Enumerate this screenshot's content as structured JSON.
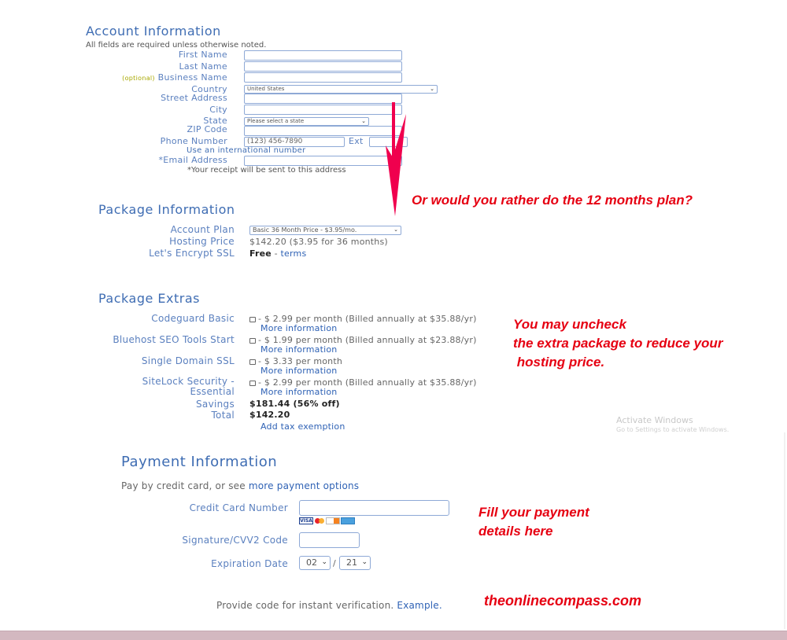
{
  "account": {
    "title": "Account Information",
    "required_note": "All fields are required unless otherwise noted.",
    "first_name_label": "First Name",
    "last_name_label": "Last Name",
    "optional_tag": "(optional)",
    "business_name_label": "Business Name",
    "country_label": "Country",
    "country_value": "United States",
    "street_label": "Street Address",
    "city_label": "City",
    "state_label": "State",
    "state_value": "Please select a state",
    "zip_label": "ZIP Code",
    "phone_label": "Phone Number",
    "phone_placeholder": "(123) 456-7890",
    "ext_label": "Ext",
    "intl_link": "Use an international number",
    "email_label": "*Email Address",
    "email_note": "*Your receipt will be sent to this address"
  },
  "package": {
    "title": "Package Information",
    "plan_label": "Account Plan",
    "plan_value": "Basic 36 Month Price - $3.95/mo.",
    "price_label": "Hosting Price",
    "price_value": "$142.20  ($3.95 for 36 months)",
    "ssl_label": "Let's Encrypt SSL",
    "ssl_value": "Free",
    "ssl_sep": " - ",
    "ssl_terms": "terms"
  },
  "extras": {
    "title": "Package Extras",
    "items": [
      {
        "label": "Codeguard Basic",
        "price": "- $ 2.99 per month (Billed annually at $35.88/yr)",
        "more": "More information",
        "checked": false
      },
      {
        "label": "Bluehost SEO Tools Start",
        "price": "- $ 1.99 per month (Billed annually at $23.88/yr)",
        "more": "More information",
        "checked": false
      },
      {
        "label": "Single Domain SSL",
        "price": "- $ 3.33 per month",
        "more": "More information",
        "checked": false
      },
      {
        "label_line1": "SiteLock Security -",
        "label_line2": "Essential",
        "price": "- $ 2.99 per month (Billed annually at $35.88/yr)",
        "more": "More information",
        "checked": false
      }
    ],
    "savings_label": "Savings",
    "savings_value": "$181.44 (56% off)",
    "total_label": "Total",
    "total_value": "$142.20",
    "tax_link": "Add tax exemption"
  },
  "payment": {
    "title": "Payment Information",
    "intro": "Pay by credit card, or see ",
    "intro_link": "more payment options",
    "cc_label": "Credit Card Number",
    "card_logos": [
      "VISA",
      "mastercard",
      "DISCOVER",
      "AMEX"
    ],
    "cvv_label": "Signature/CVV2 Code",
    "exp_label": "Expiration Date",
    "exp_month": "02",
    "exp_sep": "/",
    "exp_year": "21",
    "verify_text": "Provide code for instant verification. ",
    "verify_link": "Example."
  },
  "annotations": {
    "plan_question": "Or would you rather do the 12 months plan?",
    "extras_line1": "You may uncheck",
    "extras_line2": "the extra package to reduce your",
    "extras_line3": " hosting price.",
    "payment_line1": "Fill your payment",
    "payment_line2": "details here",
    "site": "theonlinecompass.com",
    "arrow_color": "#f0004e",
    "text_color": "#e60012"
  },
  "watermark": {
    "line1": "Activate Windows",
    "line2": "Go to Settings to activate Windows."
  }
}
